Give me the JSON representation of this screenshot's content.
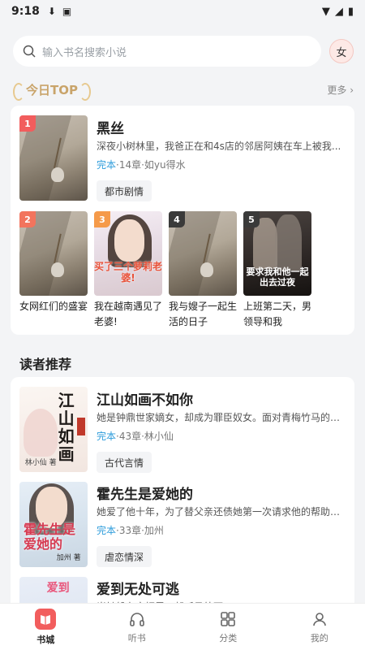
{
  "status_bar": {
    "time": "9:18"
  },
  "search": {
    "placeholder": "输入书名搜索小说"
  },
  "avatar": {
    "label": "女"
  },
  "top_section": {
    "title": "今日TOP",
    "more": "更多"
  },
  "top_books": [
    {
      "rank": "1",
      "title": "黑丝",
      "desc": "深夜小树林里，我爸正在和4s店的邻居阿姨在车上被我...",
      "status": "完本",
      "meta": "·14章·如yu得水",
      "tag": "都市剧情"
    },
    {
      "rank": "2",
      "title": "女网红们的盛宴"
    },
    {
      "rank": "3",
      "title": "我在越南遇见了老婆!",
      "cover_text": "买了三个萝莉老婆!"
    },
    {
      "rank": "4",
      "title": "我与嫂子一起生活的日子"
    },
    {
      "rank": "5",
      "title": "上班第二天，男领导和我",
      "cover_text": "要求我和他一起出去过夜"
    }
  ],
  "rec_section": {
    "title": "读者推荐"
  },
  "rec_books": [
    {
      "title": "江山如画不如你",
      "desc": "她是钟鼎世家嫡女，却成为罪臣奴女。面对青梅竹马的少...",
      "status": "完本",
      "meta": "·43章·林小仙",
      "tag": "古代言情",
      "cover_text": "江山如画",
      "cover_author": "林小仙 著"
    },
    {
      "title": "霍先生是爱她的",
      "desc": "她爱了他十年，为了替父亲还债她第一次请求他的帮助，...",
      "status": "完本",
      "meta": "·33章·加州",
      "tag": "虐恋情深",
      "cover_text": "霍先生是爱她的",
      "cover_author": "加州 著"
    },
    {
      "title": "爱到无处可逃",
      "desc": "当她躲在衣柜里，却听见外面……",
      "cover_text": "爱到"
    }
  ],
  "tabs": [
    {
      "label": "书城",
      "icon": "book-icon",
      "active": true
    },
    {
      "label": "听书",
      "icon": "headphones-icon",
      "active": false
    },
    {
      "label": "分类",
      "icon": "grid-icon",
      "active": false
    },
    {
      "label": "我的",
      "icon": "user-icon",
      "active": false
    }
  ],
  "colors": {
    "accent": "#f25d5d",
    "link": "#2d9cdb",
    "background": "#f3f4f6"
  }
}
